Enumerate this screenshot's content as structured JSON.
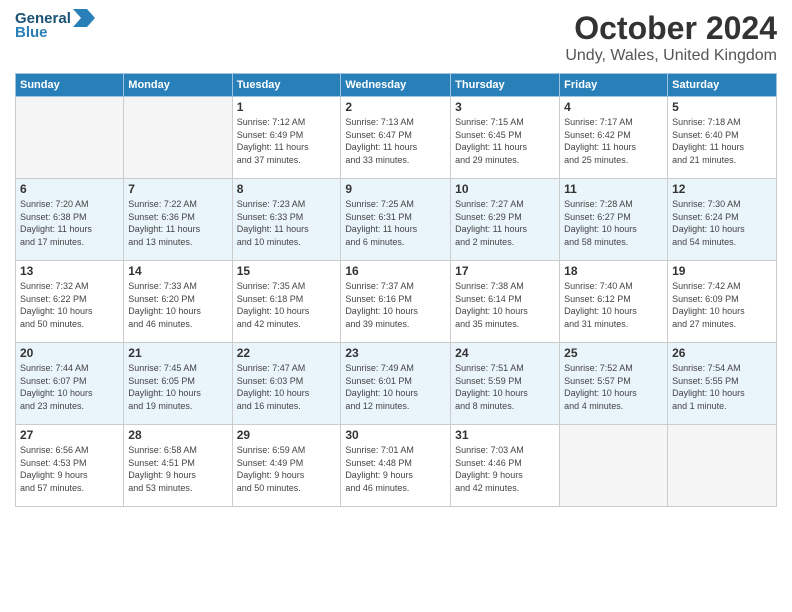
{
  "header": {
    "logo_general": "General",
    "logo_blue": "Blue",
    "month_title": "October 2024",
    "location": "Undy, Wales, United Kingdom"
  },
  "weekdays": [
    "Sunday",
    "Monday",
    "Tuesday",
    "Wednesday",
    "Thursday",
    "Friday",
    "Saturday"
  ],
  "weeks": [
    [
      {
        "day": "",
        "info": ""
      },
      {
        "day": "",
        "info": ""
      },
      {
        "day": "1",
        "info": "Sunrise: 7:12 AM\nSunset: 6:49 PM\nDaylight: 11 hours\nand 37 minutes."
      },
      {
        "day": "2",
        "info": "Sunrise: 7:13 AM\nSunset: 6:47 PM\nDaylight: 11 hours\nand 33 minutes."
      },
      {
        "day": "3",
        "info": "Sunrise: 7:15 AM\nSunset: 6:45 PM\nDaylight: 11 hours\nand 29 minutes."
      },
      {
        "day": "4",
        "info": "Sunrise: 7:17 AM\nSunset: 6:42 PM\nDaylight: 11 hours\nand 25 minutes."
      },
      {
        "day": "5",
        "info": "Sunrise: 7:18 AM\nSunset: 6:40 PM\nDaylight: 11 hours\nand 21 minutes."
      }
    ],
    [
      {
        "day": "6",
        "info": "Sunrise: 7:20 AM\nSunset: 6:38 PM\nDaylight: 11 hours\nand 17 minutes."
      },
      {
        "day": "7",
        "info": "Sunrise: 7:22 AM\nSunset: 6:36 PM\nDaylight: 11 hours\nand 13 minutes."
      },
      {
        "day": "8",
        "info": "Sunrise: 7:23 AM\nSunset: 6:33 PM\nDaylight: 11 hours\nand 10 minutes."
      },
      {
        "day": "9",
        "info": "Sunrise: 7:25 AM\nSunset: 6:31 PM\nDaylight: 11 hours\nand 6 minutes."
      },
      {
        "day": "10",
        "info": "Sunrise: 7:27 AM\nSunset: 6:29 PM\nDaylight: 11 hours\nand 2 minutes."
      },
      {
        "day": "11",
        "info": "Sunrise: 7:28 AM\nSunset: 6:27 PM\nDaylight: 10 hours\nand 58 minutes."
      },
      {
        "day": "12",
        "info": "Sunrise: 7:30 AM\nSunset: 6:24 PM\nDaylight: 10 hours\nand 54 minutes."
      }
    ],
    [
      {
        "day": "13",
        "info": "Sunrise: 7:32 AM\nSunset: 6:22 PM\nDaylight: 10 hours\nand 50 minutes."
      },
      {
        "day": "14",
        "info": "Sunrise: 7:33 AM\nSunset: 6:20 PM\nDaylight: 10 hours\nand 46 minutes."
      },
      {
        "day": "15",
        "info": "Sunrise: 7:35 AM\nSunset: 6:18 PM\nDaylight: 10 hours\nand 42 minutes."
      },
      {
        "day": "16",
        "info": "Sunrise: 7:37 AM\nSunset: 6:16 PM\nDaylight: 10 hours\nand 39 minutes."
      },
      {
        "day": "17",
        "info": "Sunrise: 7:38 AM\nSunset: 6:14 PM\nDaylight: 10 hours\nand 35 minutes."
      },
      {
        "day": "18",
        "info": "Sunrise: 7:40 AM\nSunset: 6:12 PM\nDaylight: 10 hours\nand 31 minutes."
      },
      {
        "day": "19",
        "info": "Sunrise: 7:42 AM\nSunset: 6:09 PM\nDaylight: 10 hours\nand 27 minutes."
      }
    ],
    [
      {
        "day": "20",
        "info": "Sunrise: 7:44 AM\nSunset: 6:07 PM\nDaylight: 10 hours\nand 23 minutes."
      },
      {
        "day": "21",
        "info": "Sunrise: 7:45 AM\nSunset: 6:05 PM\nDaylight: 10 hours\nand 19 minutes."
      },
      {
        "day": "22",
        "info": "Sunrise: 7:47 AM\nSunset: 6:03 PM\nDaylight: 10 hours\nand 16 minutes."
      },
      {
        "day": "23",
        "info": "Sunrise: 7:49 AM\nSunset: 6:01 PM\nDaylight: 10 hours\nand 12 minutes."
      },
      {
        "day": "24",
        "info": "Sunrise: 7:51 AM\nSunset: 5:59 PM\nDaylight: 10 hours\nand 8 minutes."
      },
      {
        "day": "25",
        "info": "Sunrise: 7:52 AM\nSunset: 5:57 PM\nDaylight: 10 hours\nand 4 minutes."
      },
      {
        "day": "26",
        "info": "Sunrise: 7:54 AM\nSunset: 5:55 PM\nDaylight: 10 hours\nand 1 minute."
      }
    ],
    [
      {
        "day": "27",
        "info": "Sunrise: 6:56 AM\nSunset: 4:53 PM\nDaylight: 9 hours\nand 57 minutes."
      },
      {
        "day": "28",
        "info": "Sunrise: 6:58 AM\nSunset: 4:51 PM\nDaylight: 9 hours\nand 53 minutes."
      },
      {
        "day": "29",
        "info": "Sunrise: 6:59 AM\nSunset: 4:49 PM\nDaylight: 9 hours\nand 50 minutes."
      },
      {
        "day": "30",
        "info": "Sunrise: 7:01 AM\nSunset: 4:48 PM\nDaylight: 9 hours\nand 46 minutes."
      },
      {
        "day": "31",
        "info": "Sunrise: 7:03 AM\nSunset: 4:46 PM\nDaylight: 9 hours\nand 42 minutes."
      },
      {
        "day": "",
        "info": ""
      },
      {
        "day": "",
        "info": ""
      }
    ]
  ]
}
